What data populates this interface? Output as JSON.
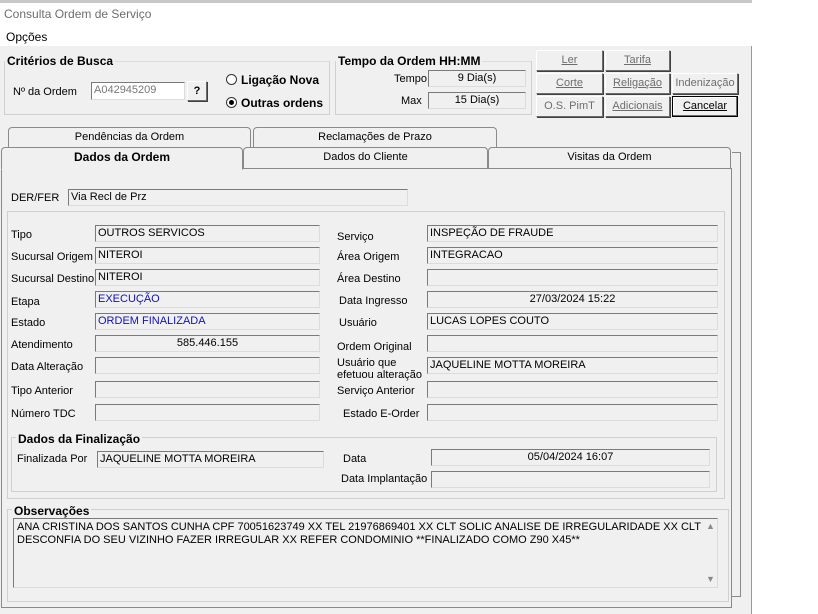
{
  "window": {
    "title": "Consulta Ordem de Serviço"
  },
  "menu": {
    "options": "Opções"
  },
  "search": {
    "title": "Critérios de Busca",
    "order_label": "Nº da Ordem",
    "order_value": "A042945209",
    "help_button": "?",
    "radio_ligacao": "Ligação Nova",
    "radio_outras": "Outras ordens",
    "selected": "outras"
  },
  "time": {
    "title": "Tempo da Ordem HH:MM",
    "tempo_label": "Tempo",
    "tempo_value": "9 Dia(s)",
    "max_label": "Max",
    "max_value": "15 Dia(s)"
  },
  "buttons": {
    "ler": "Ler",
    "tarifa": "Tarifa",
    "corte": "Corte",
    "religacao": "Religação",
    "indenizacao": "Indenização",
    "os_pimt": "O.S. PimT",
    "adicionais": "Adicionais",
    "cancelar": "Cancelar"
  },
  "tabs": {
    "pendencias": "Pendências da Ordem",
    "reclamacoes": "Reclamações de Prazo",
    "dados_ordem": "Dados da Ordem",
    "dados_cliente": "Dados do Cliente",
    "visitas": "Visitas da Ordem"
  },
  "der": {
    "label": "DER/FER",
    "value": "Via Recl de Prz"
  },
  "fields": {
    "tipo": {
      "label": "Tipo",
      "value": "OUTROS SERVICOS"
    },
    "sucursal_origem": {
      "label": "Sucursal Origem",
      "value": "NITEROI"
    },
    "sucursal_destino": {
      "label": "Sucursal Destino",
      "value": "NITEROI"
    },
    "etapa": {
      "label": "Etapa",
      "value": "EXECUÇÃO"
    },
    "estado": {
      "label": "Estado",
      "value": "ORDEM FINALIZADA"
    },
    "atendimento": {
      "label": "Atendimento",
      "value": "585.446.155"
    },
    "data_alteracao": {
      "label": "Data Alteração",
      "value": ""
    },
    "tipo_anterior": {
      "label": "Tipo Anterior",
      "value": ""
    },
    "numero_tdc": {
      "label": "Número TDC",
      "value": ""
    },
    "servico": {
      "label": "Serviço",
      "value": "INSPEÇÃO DE FRAUDE"
    },
    "area_origem": {
      "label": "Área Origem",
      "value": "INTEGRACAO"
    },
    "area_destino": {
      "label": "Área Destino",
      "value": ""
    },
    "data_ingresso": {
      "label": "Data Ingresso",
      "value": "27/03/2024 15:22"
    },
    "usuario": {
      "label": "Usuário",
      "value": "LUCAS LOPES COUTO"
    },
    "ordem_original": {
      "label": "Ordem Original",
      "value": ""
    },
    "usuario_alteracao": {
      "label_1": "Usuário que",
      "label_2": "efetuou alteração",
      "value": "JAQUELINE MOTTA MOREIRA"
    },
    "servico_anterior": {
      "label": "Serviço Anterior",
      "value": ""
    },
    "estado_eorder": {
      "label": "Estado E-Order",
      "value": ""
    }
  },
  "finalizacao": {
    "title": "Dados da Finalização",
    "finalizada_por_label": "Finalizada Por",
    "finalizada_por_value": "JAQUELINE MOTTA MOREIRA",
    "data_label": "Data",
    "data_value": "05/04/2024 16:07",
    "data_implantacao_label": "Data Implantação",
    "data_implantacao_value": ""
  },
  "observacoes": {
    "title": "Observações",
    "line1": "ANA CRISTINA DOS SANTOS CUNHA CPF 70051623749 XX TEL 21976869401 XX CLT SOLIC ANALISE DE IRREGULARIDADE XX CLT",
    "line2": "DESCONFIA DO SEU VIZINHO FAZER IRREGULAR XX REFER CONDOMINIO **FINALIZADO COMO Z90 X45**"
  },
  "colors": {
    "window_bg": "#f0f0f0",
    "value_blue": "#1010c0",
    "disabled_text": "#6d6d6d"
  }
}
